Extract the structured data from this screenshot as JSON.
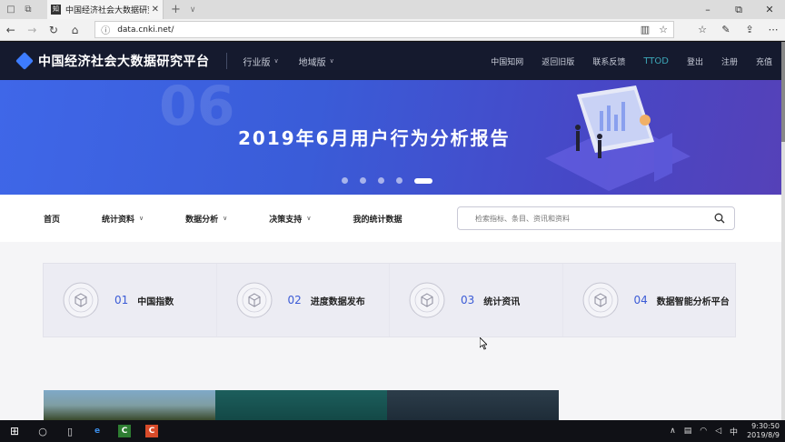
{
  "browser": {
    "tab": {
      "favicon": "cnki-favicon",
      "title": "中国经济社会大数据研究"
    },
    "url": "data.cnki.net/"
  },
  "header": {
    "site_title": "中国经济社会大数据研究平台",
    "menus": [
      "行业版",
      "地域版"
    ],
    "links": [
      "中国知网",
      "返回旧版",
      "联系反馈",
      "TTOD",
      "登出",
      "注册",
      "充值"
    ]
  },
  "banner": {
    "ghost_text": "06",
    "title": "2019年6月用户行为分析报告",
    "slide_count": 5,
    "active_slide": 5
  },
  "nav": {
    "items": [
      {
        "label": "首页",
        "has_dropdown": false
      },
      {
        "label": "统计资料",
        "has_dropdown": true
      },
      {
        "label": "数据分析",
        "has_dropdown": true
      },
      {
        "label": "决策支持",
        "has_dropdown": true
      },
      {
        "label": "我的统计数据",
        "has_dropdown": false
      }
    ],
    "search_placeholder": "检索指标、条目、资讯和资料"
  },
  "cards": [
    {
      "num": "01",
      "label": "中国指数"
    },
    {
      "num": "02",
      "label": "进度数据发布"
    },
    {
      "num": "03",
      "label": "统计资讯"
    },
    {
      "num": "04",
      "label": "数据智能分析平台"
    }
  ],
  "taskbar": {
    "tray_lang": "中",
    "time": "9:30:50",
    "date": "2019/8/9"
  },
  "colors": {
    "header_bg": "#151a2e",
    "accent_blue": "#3b5bd6",
    "ttod_link": "#3ca7b8",
    "banner_start": "#3f67e8",
    "banner_end": "#5541b8"
  }
}
